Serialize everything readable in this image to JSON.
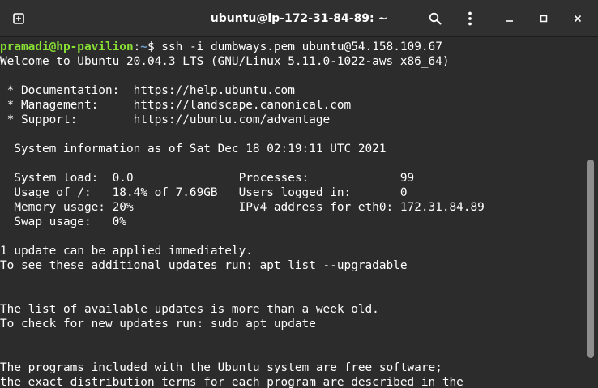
{
  "window": {
    "title": "ubuntu@ip-172-31-84-89: ~"
  },
  "toolbar": {
    "new_tab_icon": "new-tab-icon",
    "search_icon": "search-icon",
    "menu_icon": "kebab-menu-icon",
    "minimize_icon": "minimize-icon",
    "maximize_icon": "maximize-icon",
    "close_icon": "close-icon"
  },
  "colors": {
    "background": "#2c2c2c",
    "titlebar": "#303030",
    "text": "#ffffff",
    "prompt_user": "#8ae234",
    "prompt_path": "#729fcf"
  },
  "prompt": {
    "user_host": "pramadi@hp-pavilion",
    "separator": ":",
    "path": "~",
    "symbol": "$ ",
    "command": "ssh -i dumbways.pem ubuntu@54.158.109.67"
  },
  "output": {
    "lines": [
      "Welcome to Ubuntu 20.04.3 LTS (GNU/Linux 5.11.0-1022-aws x86_64)",
      "",
      " * Documentation:  https://help.ubuntu.com",
      " * Management:     https://landscape.canonical.com",
      " * Support:        https://ubuntu.com/advantage",
      "",
      "  System information as of Sat Dec 18 02:19:11 UTC 2021",
      "",
      "  System load:  0.0               Processes:             99",
      "  Usage of /:   18.4% of 7.69GB   Users logged in:       0",
      "  Memory usage: 20%               IPv4 address for eth0: 172.31.84.89",
      "  Swap usage:   0%",
      "",
      "1 update can be applied immediately.",
      "To see these additional updates run: apt list --upgradable",
      "",
      "",
      "The list of available updates is more than a week old.",
      "To check for new updates run: sudo apt update",
      "",
      "",
      "The programs included with the Ubuntu system are free software;",
      "the exact distribution terms for each program are described in the"
    ]
  }
}
